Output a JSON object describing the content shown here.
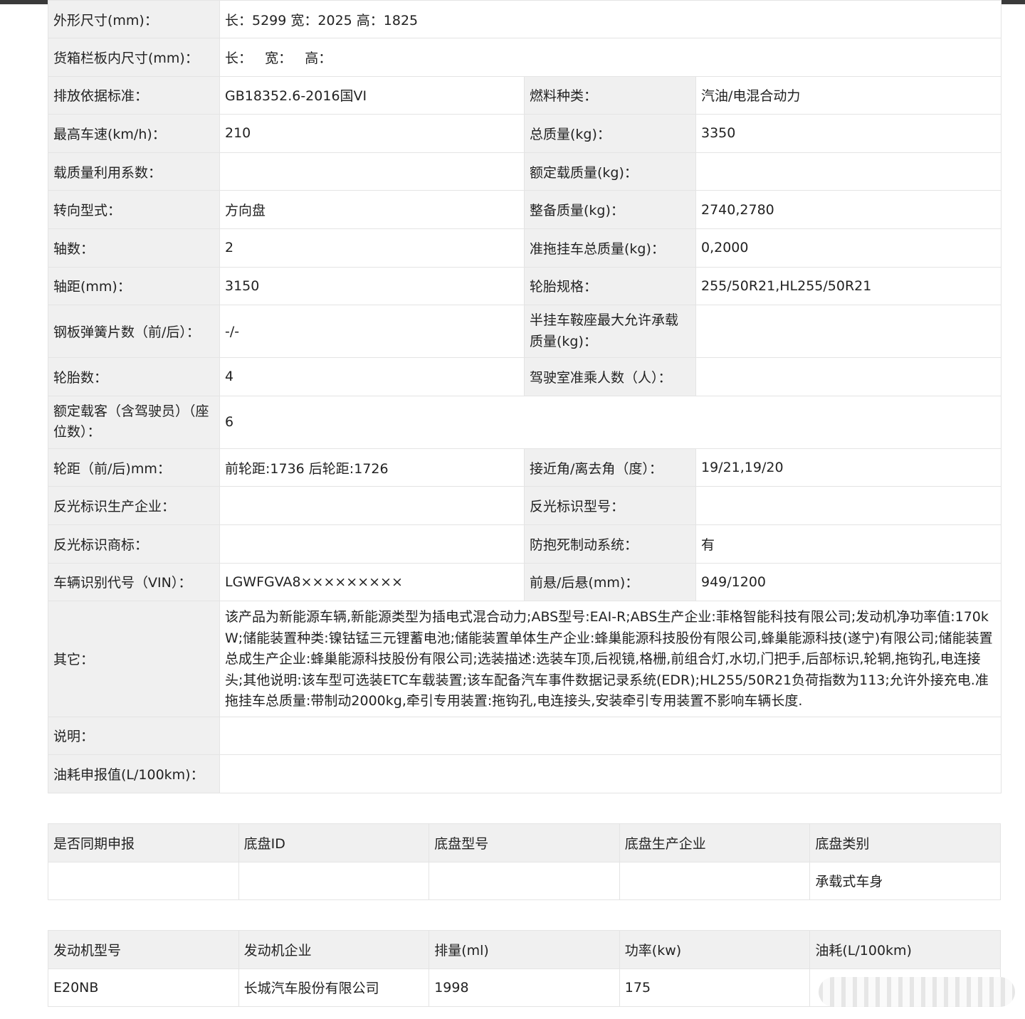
{
  "main_table": {
    "dimensions": {
      "label": "外形尺寸(mm)：",
      "value": "长：5299 宽：2025 高：1825"
    },
    "cargo_box": {
      "label": "货箱栏板内尺寸(mm)：",
      "value": "长：   宽：   高："
    },
    "rows": [
      {
        "l1": "排放依据标准：",
        "v1": "GB18352.6-2016国VI",
        "l2": "燃料种类：",
        "v2": "汽油/电混合动力"
      },
      {
        "l1": "最高车速(km/h)：",
        "v1": "210",
        "l2": "总质量(kg)：",
        "v2": "3350"
      },
      {
        "l1": "载质量利用系数：",
        "v1": "",
        "l2": "额定载质量(kg)：",
        "v2": ""
      },
      {
        "l1": "转向型式：",
        "v1": "方向盘",
        "l2": "整备质量(kg)：",
        "v2": "2740,2780"
      },
      {
        "l1": "轴数：",
        "v1": "2",
        "l2": "准拖挂车总质量(kg)：",
        "v2": "0,2000"
      },
      {
        "l1": "轴距(mm)：",
        "v1": "3150",
        "l2": "轮胎规格：",
        "v2": "255/50R21,HL255/50R21"
      },
      {
        "l1": "钢板弹簧片数（前/后）：",
        "v1": "-/-",
        "l2": "半挂车鞍座最大允许承载质量(kg)：",
        "v2": ""
      },
      {
        "l1": "轮胎数：",
        "v1": "4",
        "l2": "驾驶室准乘人数（人）：",
        "v2": ""
      }
    ],
    "seats": {
      "label": "额定载客（含驾驶员）（座位数）：",
      "value": "6"
    },
    "rows2": [
      {
        "l1": "轮距（前/后)mm：",
        "v1": "前轮距:1736 后轮距:1726",
        "l2": "接近角/离去角（度）：",
        "v2": "19/21,19/20"
      },
      {
        "l1": "反光标识生产企业：",
        "v1": "",
        "l2": "反光标识型号：",
        "v2": ""
      },
      {
        "l1": "反光标识商标：",
        "v1": "",
        "l2": "防抱死制动系统：",
        "v2": "有"
      },
      {
        "l1": "车辆识别代号（VIN）：",
        "v1": "LGWFGVA8×××××××××",
        "l2": "前悬/后悬(mm)：",
        "v2": "949/1200"
      }
    ],
    "other": {
      "label": "其它：",
      "value": "该产品为新能源车辆,新能源类型为插电式混合动力;ABS型号:EAI-R;ABS生产企业:菲格智能科技有限公司;发动机净功率值:170kW;储能装置种类:镍钴锰三元锂蓄电池;储能装置单体生产企业:蜂巢能源科技股份有限公司,蜂巢能源科技(遂宁)有限公司;储能装置总成生产企业:蜂巢能源科技股份有限公司;选装描述:选装车顶,后视镜,格栅,前组合灯,水切,门把手,后部标识,轮辋,拖钩孔,电连接头;其他说明:该车型可选装ETC车载装置;该车配备汽车事件数据记录系统(EDR);HL255/50R21负荷指数为113;允许外接充电.准拖挂车总质量:带制动2000kg,牵引专用装置:拖钩孔,电连接头,安装牵引专用装置不影响车辆长度."
    },
    "note": {
      "label": "说明：",
      "value": ""
    },
    "fuel": {
      "label": "油耗申报值(L/100km)：",
      "value": ""
    }
  },
  "chassis_table": {
    "headers": [
      "是否同期申报",
      "底盘ID",
      "底盘型号",
      "底盘生产企业",
      "底盘类别"
    ],
    "row": [
      "",
      "",
      "",
      "",
      "承载式车身"
    ]
  },
  "engine_table": {
    "headers": [
      "发动机型号",
      "发动机企业",
      "排量(ml)",
      "功率(kw)",
      "油耗(L/100km)"
    ],
    "row": [
      "E20NB",
      "长城汽车股份有限公司",
      "1998",
      "175",
      ""
    ]
  }
}
